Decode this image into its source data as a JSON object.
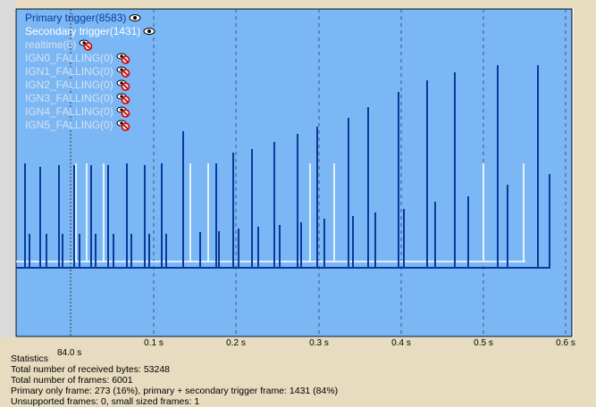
{
  "legend": [
    {
      "label": "Primary trigger(8583)",
      "color": "#0a3a9a",
      "active": true
    },
    {
      "label": "Secondary trigger(1431)",
      "color": "#ffffff",
      "active": true
    },
    {
      "label": "realtime(0)",
      "color": "#d6e2ef",
      "active": false
    },
    {
      "label": "IGN0_FALLING(0)",
      "color": "#d6e2ef",
      "active": false
    },
    {
      "label": "IGN1_FALLING(0)",
      "color": "#d6e2ef",
      "active": false
    },
    {
      "label": "IGN2_FALLING(0)",
      "color": "#d6e2ef",
      "active": false
    },
    {
      "label": "IGN3_FALLING(0)",
      "color": "#d6e2ef",
      "active": false
    },
    {
      "label": "IGN4_FALLING(0)",
      "color": "#d6e2ef",
      "active": false
    },
    {
      "label": "IGN5_FALLING(0)",
      "color": "#d6e2ef",
      "active": false
    }
  ],
  "axis": {
    "ticks": [
      "0.1 s",
      "0.2 s",
      "0.3 s",
      "0.4 s",
      "0.5 s",
      "0.6 s"
    ],
    "cursor_label": "84.0 s"
  },
  "stats": {
    "title": "Statistics",
    "lines": [
      "Total number of received bytes: 53248",
      "Total number of frames: 6001",
      "Primary only frame: 273 (16%), primary + secondary trigger frame: 1431 (84%)",
      "Unsupported frames: 0, small sized frames: 1"
    ]
  },
  "colors": {
    "plot_bg": "#7cb7f5",
    "primary": "#0a3a9a",
    "secondary": "#ffffff",
    "grid": "#3a5a80",
    "cursor": "#333333"
  }
}
